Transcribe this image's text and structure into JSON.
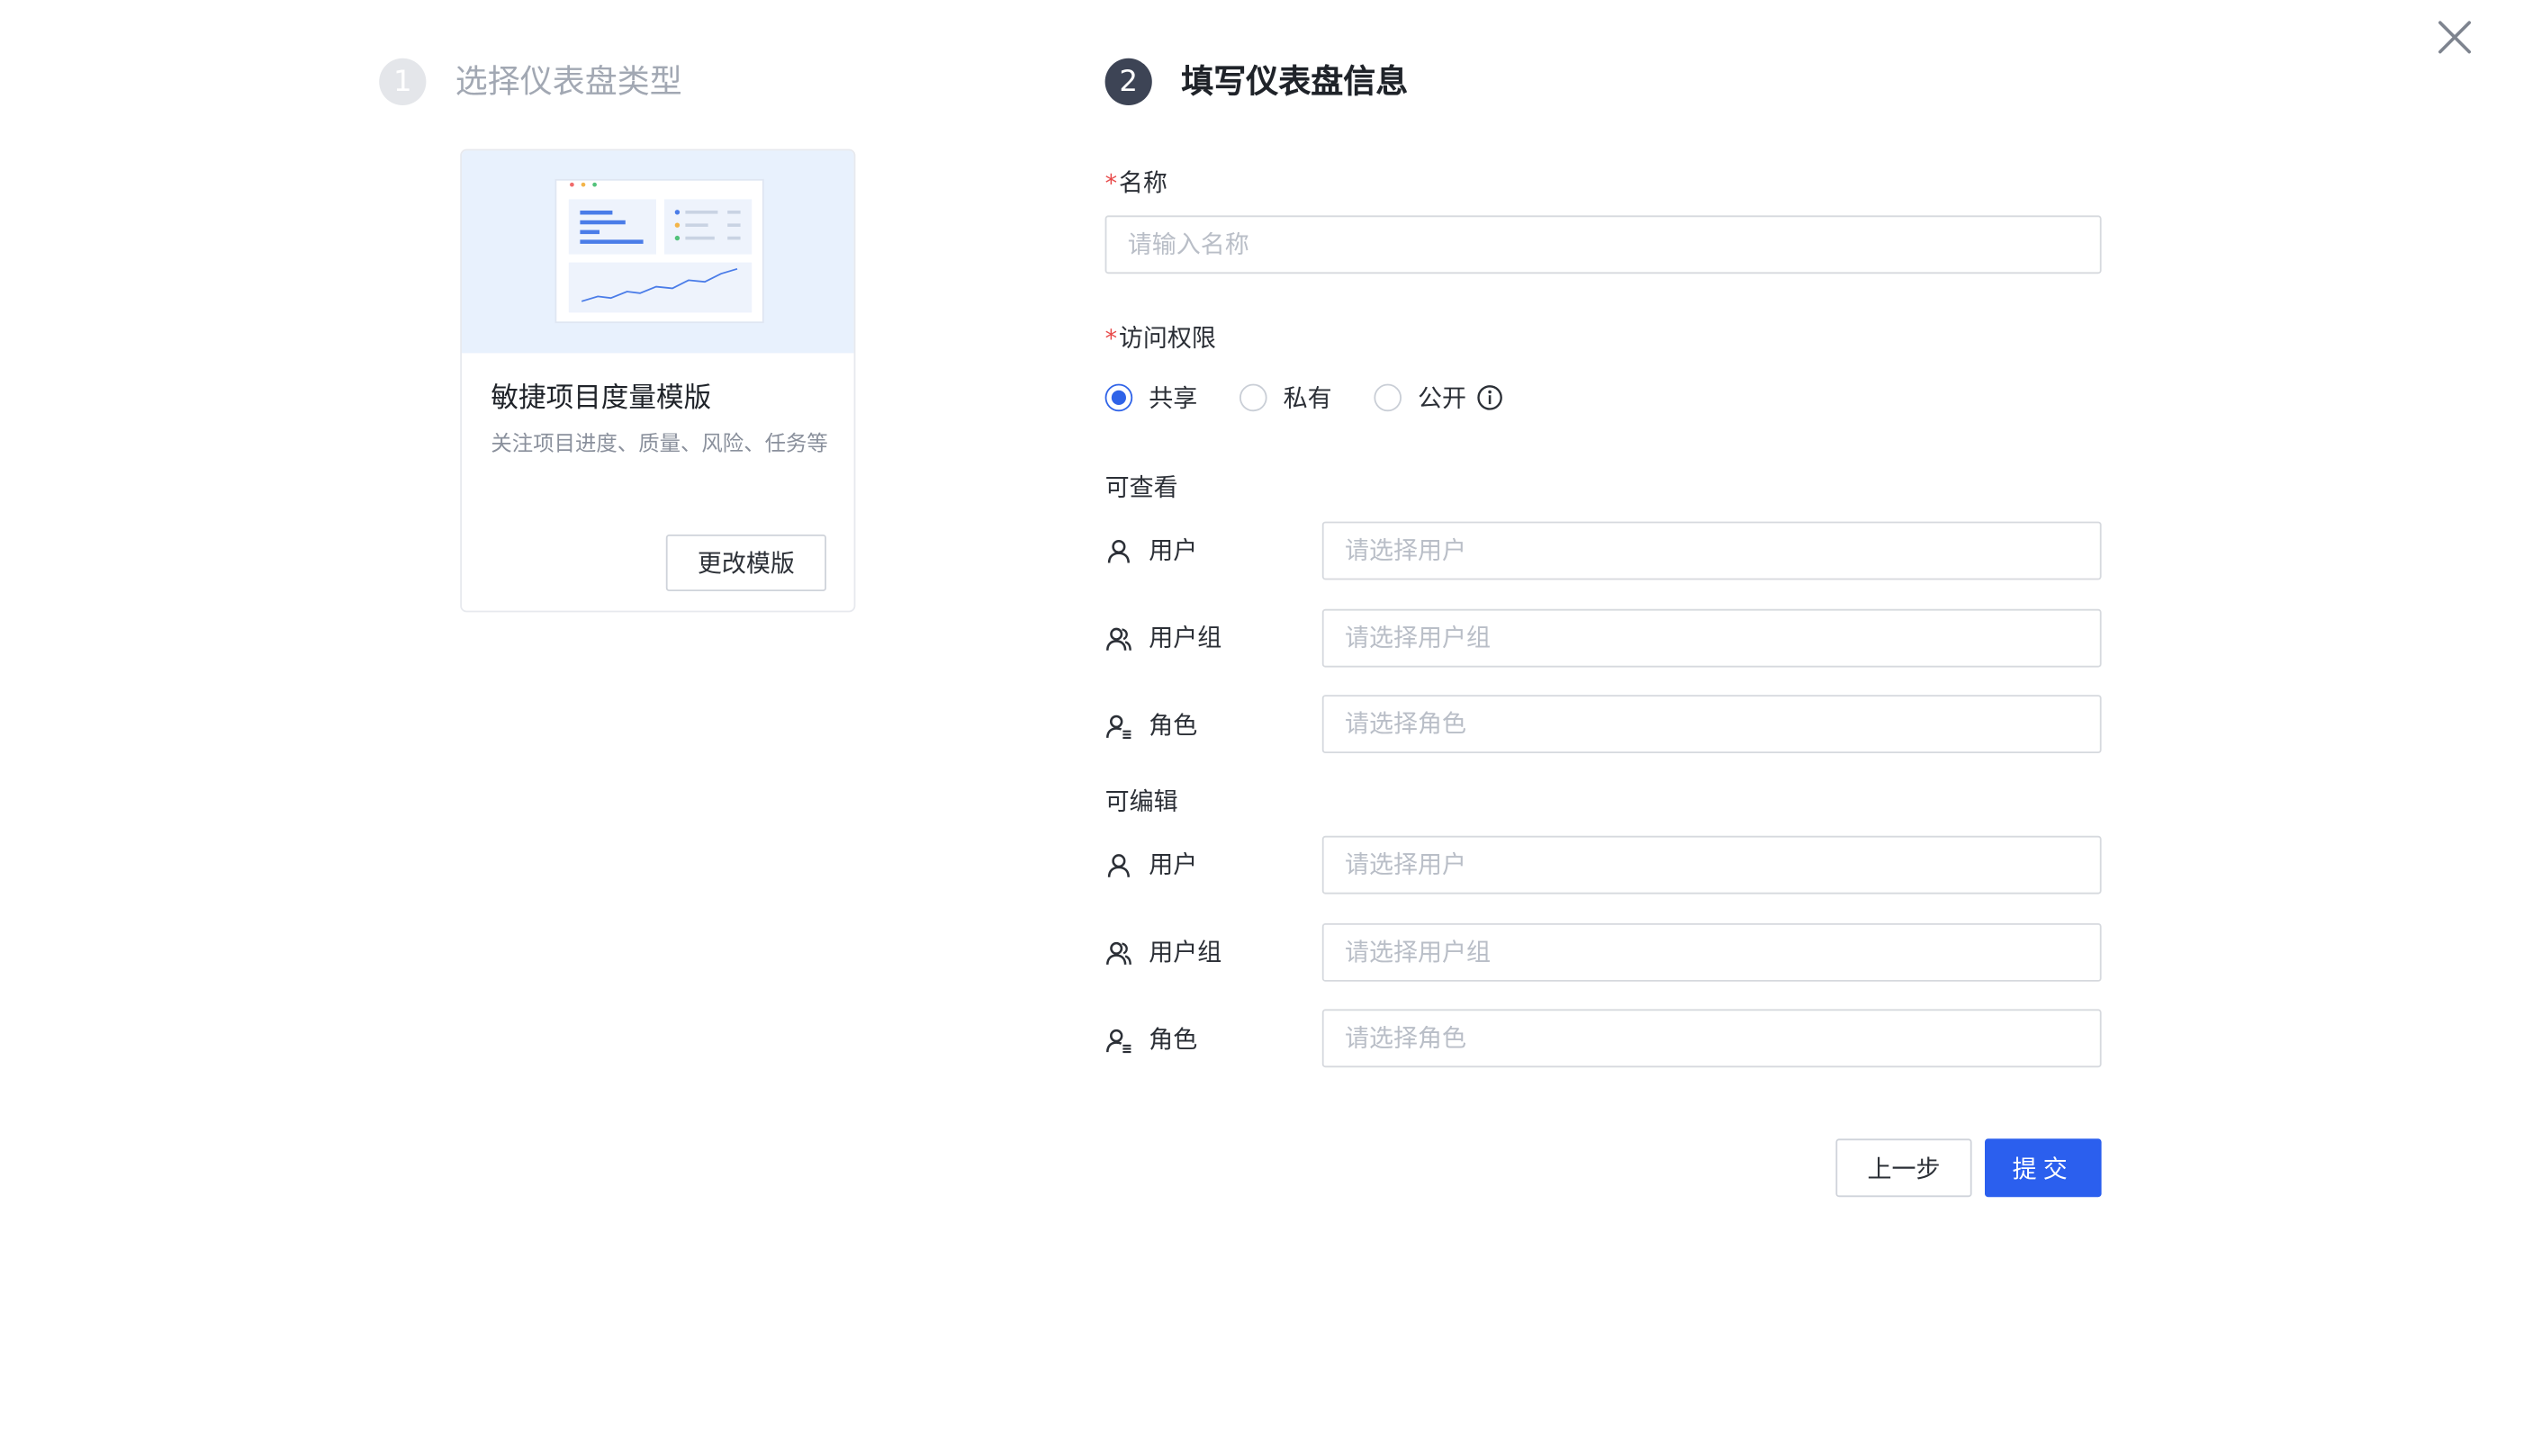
{
  "steps": [
    {
      "number": "1",
      "title": "选择仪表盘类型"
    },
    {
      "number": "2",
      "title": "填写仪表盘信息"
    }
  ],
  "template_card": {
    "title": "敏捷项目度量模版",
    "description": "关注项目进度、质量、风险、任务等",
    "change_button": "更改模版"
  },
  "form": {
    "name_label": "名称",
    "name_placeholder": "请输入名称",
    "required_mark": "*",
    "access_label": "访问权限",
    "access_options": [
      {
        "label": "共享",
        "checked": true
      },
      {
        "label": "私有",
        "checked": false
      },
      {
        "label": "公开",
        "checked": false
      }
    ],
    "view_section": {
      "title": "可查看",
      "rows": [
        {
          "label": "用户",
          "icon": "user-icon",
          "placeholder": "请选择用户"
        },
        {
          "label": "用户组",
          "icon": "user-group-icon",
          "placeholder": "请选择用户组"
        },
        {
          "label": "角色",
          "icon": "role-icon",
          "placeholder": "请选择角色"
        }
      ]
    },
    "edit_section": {
      "title": "可编辑",
      "rows": [
        {
          "label": "用户",
          "icon": "user-icon",
          "placeholder": "请选择用户"
        },
        {
          "label": "用户组",
          "icon": "user-group-icon",
          "placeholder": "请选择用户组"
        },
        {
          "label": "角色",
          "icon": "role-icon",
          "placeholder": "请选择角色"
        }
      ]
    }
  },
  "footer": {
    "prev_button": "上一步",
    "submit_button": "提交"
  },
  "colors": {
    "primary": "#2b5fee",
    "required": "#e84a4a",
    "radio_checked": "#2f63e8"
  }
}
